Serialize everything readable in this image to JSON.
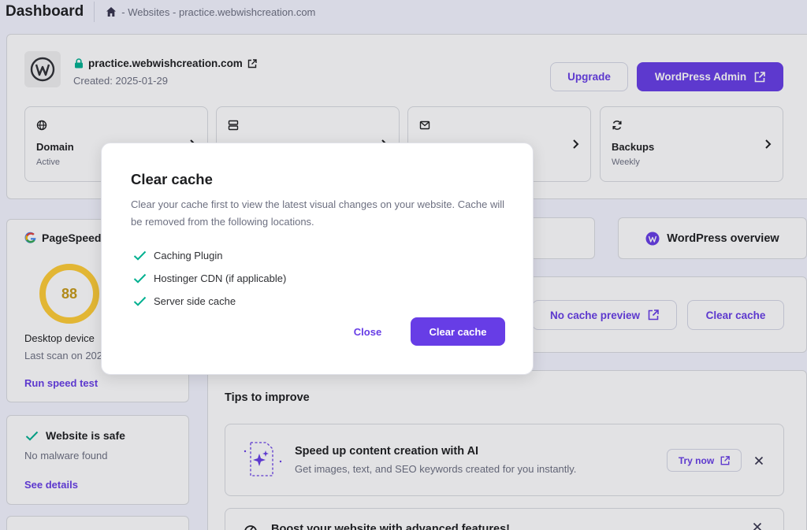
{
  "header": {
    "title": "Dashboard",
    "breadcrumb": "- Websites - practice.webwishcreation.com"
  },
  "site": {
    "url": "practice.webwishcreation.com",
    "created": "Created: 2025-01-29",
    "upgrade_label": "Upgrade",
    "wp_admin_label": "WordPress Admin"
  },
  "tiles": [
    {
      "label": "Domain",
      "sub": "Active",
      "icon": "globe-icon"
    },
    {
      "label": "",
      "sub": "",
      "icon": "server-icon"
    },
    {
      "label": "",
      "sub": "",
      "icon": "mail-icon"
    },
    {
      "label": "Backups",
      "sub": "Weekly",
      "icon": "refresh-icon"
    }
  ],
  "pagespeed": {
    "title": "PageSpeed",
    "score": "88",
    "device": "Desktop device",
    "last_scan": "Last scan on 202",
    "run_label": "Run speed test"
  },
  "security": {
    "title": "Website is safe",
    "status": "No malware found",
    "details_label": "See details"
  },
  "wordpress_overview": "WordPress overview",
  "cache_actions": {
    "no_cache_preview": "No cache preview",
    "clear_cache": "Clear cache"
  },
  "tips": {
    "title": "Tips to improve",
    "items": [
      {
        "title": "Speed up content creation with AI",
        "sub": "Get images, text, and SEO keywords created for you instantly.",
        "action": "Try now"
      },
      {
        "title": "Boost your website with advanced features!",
        "sub": "",
        "action": ""
      }
    ]
  },
  "modal": {
    "title": "Clear cache",
    "description": "Clear your cache first to view the latest visual changes on your website. Cache will be removed from the following locations.",
    "items": [
      "Caching Plugin",
      "Hostinger CDN (if applicable)",
      "Server side cache"
    ],
    "close_label": "Close",
    "confirm_label": "Clear cache"
  },
  "colors": {
    "primary": "#673de6",
    "success": "#00b090",
    "warning": "#ffcd35",
    "text": "#1d1e20",
    "muted": "#6d7081"
  }
}
